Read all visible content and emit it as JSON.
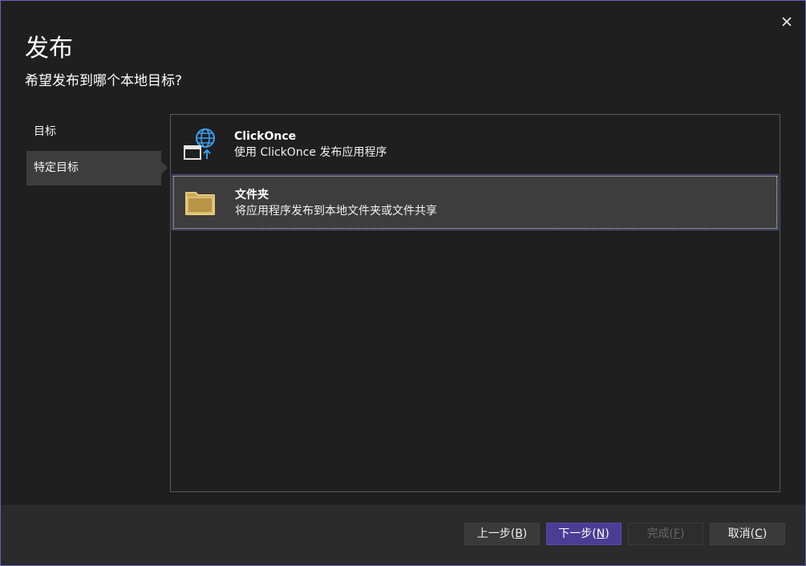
{
  "dialog": {
    "title": "发布",
    "subtitle": "希望发布到哪个本地目标?"
  },
  "nav": {
    "items": [
      {
        "label": "目标",
        "selected": false
      },
      {
        "label": "特定目标",
        "selected": true
      }
    ]
  },
  "options": [
    {
      "title": "ClickOnce",
      "description": "使用 ClickOnce 发布应用程序",
      "icon": "clickonce-globe-window-icon",
      "selected": false
    },
    {
      "title": "文件夹",
      "description": "将应用程序发布到本地文件夹或文件共享",
      "icon": "folder-icon",
      "selected": true
    }
  ],
  "buttons": {
    "back": {
      "text": "上一步(",
      "key": "B",
      "end": ")"
    },
    "next": {
      "text": "下一步(",
      "key": "N",
      "end": ")"
    },
    "finish": {
      "text": "完成(",
      "key": "F",
      "end": ")",
      "enabled": false
    },
    "cancel": {
      "text": "取消(",
      "key": "C",
      "end": ")"
    }
  },
  "colors": {
    "accent": "#4b3d94",
    "window_border": "#6b5fb5",
    "background": "#1f1f1f",
    "selected_bg": "#3d3d3d",
    "folder": "#e8c97a",
    "globe": "#3aa0f0"
  }
}
